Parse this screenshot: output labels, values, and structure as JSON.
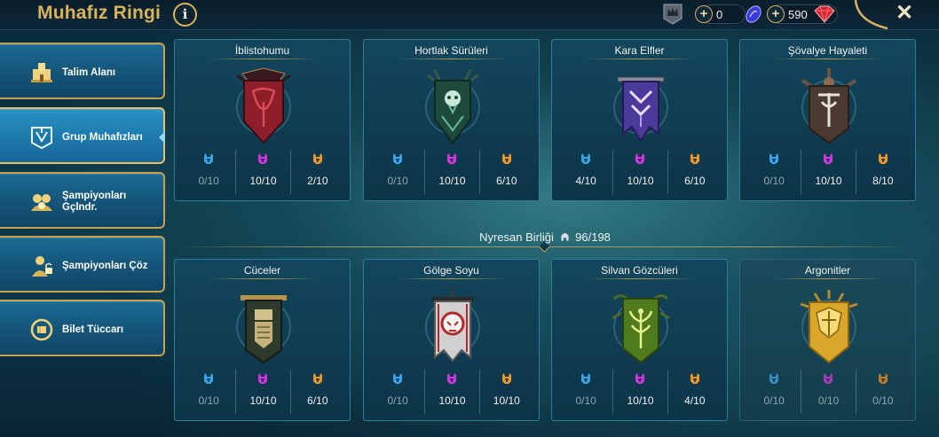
{
  "header": {
    "title": "Muhafız Ringi",
    "info_glyph": "i",
    "currency_1": "0",
    "currency_2": "590",
    "close_glyph": "✕"
  },
  "sidebar": {
    "items": [
      {
        "label": "Talim Alanı",
        "icon": "tower-icon"
      },
      {
        "label": "Grup Muhafızları",
        "icon": "guardian-banner-icon",
        "active": true
      },
      {
        "label": "Şampiyonları Gçlndr.",
        "icon": "champions-upgrade-icon"
      },
      {
        "label": "Şampiyonları Çöz",
        "icon": "champion-unlock-icon"
      },
      {
        "label": "Bilet Tüccarı",
        "icon": "ticket-icon"
      }
    ]
  },
  "alliance": {
    "name": "Nyresan Birliği",
    "count": "96/198"
  },
  "rarity_colors": {
    "rare": "#3aa3e8",
    "epic": "#d236e0",
    "legendary": "#f0962a"
  },
  "factions": [
    {
      "name": "İblistohumu",
      "rare": "0/10",
      "epic": "10/10",
      "legendary": "2/10",
      "banner_color": "#8c1f2a",
      "accent": "#d94a5a"
    },
    {
      "name": "Hortlak Sürüleri",
      "rare": "0/10",
      "epic": "10/10",
      "legendary": "6/10",
      "banner_color": "#1d4a3c",
      "accent": "#69b89a"
    },
    {
      "name": "Kara Elfler",
      "rare": "4/10",
      "epic": "10/10",
      "legendary": "6/10",
      "banner_color": "#4b3a9a",
      "accent": "#b89cf0"
    },
    {
      "name": "Şövalye Hayaleti",
      "rare": "0/10",
      "epic": "10/10",
      "legendary": "8/10",
      "banner_color": "#4a3a30",
      "accent": "#d8d0c0"
    },
    {
      "name": "Cüceler",
      "rare": "0/10",
      "epic": "10/10",
      "legendary": "6/10",
      "banner_color": "#2e3a2c",
      "accent": "#d2c189"
    },
    {
      "name": "Gölge Soyu",
      "rare": "0/10",
      "epic": "10/10",
      "legendary": "10/10",
      "banner_color": "#d0d0d0",
      "accent": "#b32a2a"
    },
    {
      "name": "Silvan Gözcüleri",
      "rare": "0/10",
      "epic": "10/10",
      "legendary": "4/10",
      "banner_color": "#4f7a1e",
      "accent": "#d7ea6a"
    },
    {
      "name": "Argonitler",
      "rare": "0/10",
      "epic": "0/10",
      "legendary": "0/10",
      "banner_color": "#d9a72a",
      "accent": "#f7dc7a"
    }
  ]
}
